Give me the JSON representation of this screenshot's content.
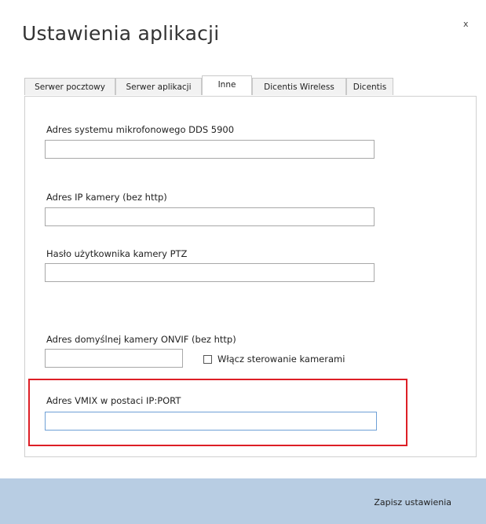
{
  "dialog": {
    "title": "Ustawienia aplikacji",
    "close_label": "x"
  },
  "tabs": [
    {
      "label": "Serwer pocztowy",
      "active": false
    },
    {
      "label": "Serwer aplikacji",
      "active": false
    },
    {
      "label": "Inne",
      "active": true
    },
    {
      "label": "Dicentis Wireless",
      "active": false
    },
    {
      "label": "Dicentis",
      "active": false
    }
  ],
  "fields": {
    "dds": {
      "label": "Adres systemu mikrofonowego DDS 5900",
      "value": ""
    },
    "camera_ip": {
      "label": "Adres IP kamery (bez http)",
      "value": ""
    },
    "ptz_password": {
      "label": "Hasło użytkownika kamery PTZ",
      "value": ""
    },
    "onvif": {
      "label": "Adres domyślnej kamery ONVIF (bez http)",
      "value": ""
    },
    "camera_control": {
      "label": "Włącz sterowanie kamerami",
      "checked": false
    },
    "vmix": {
      "label": "Adres VMIX w postaci IP:PORT",
      "value": ""
    }
  },
  "footer": {
    "save_label": "Zapisz ustawienia"
  },
  "colors": {
    "highlight": "#dd1f26",
    "footer_bg": "#b8cde3",
    "focus_border": "#6fa0d6"
  }
}
